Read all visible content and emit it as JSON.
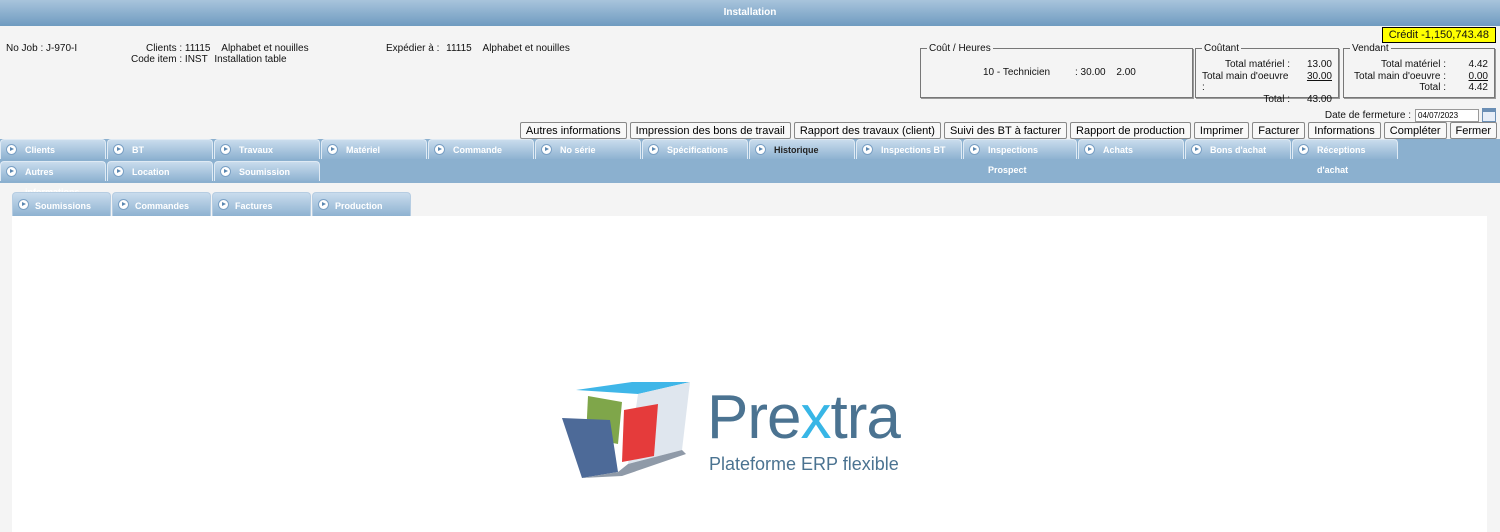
{
  "window": {
    "title": "Installation"
  },
  "credit": "Crédit -1,150,743.48",
  "job": {
    "no_job_label": "No Job :",
    "no_job_value": "J-970-I",
    "clients_label": "Clients :",
    "clients_code": "11115",
    "clients_name": "Alphabet et nouilles",
    "code_item_label": "Code item :",
    "code_item_code": "INST",
    "code_item_name": "Installation table",
    "expedier_label": "Expédier à :",
    "expedier_code": "11115",
    "expedier_name": "Alphabet et nouilles"
  },
  "cout_heures": {
    "legend": "Coût / Heures",
    "line": "10 - Technicien",
    "rate": ": 30.00",
    "hours": "2.00"
  },
  "coutant": {
    "legend": "Coûtant",
    "rows": [
      {
        "label": "Total matériel :",
        "value": "13.00"
      },
      {
        "label": "Total main d'oeuvre :",
        "value": "30.00"
      },
      {
        "label": "Total :",
        "value": "43.00"
      }
    ]
  },
  "vendant": {
    "legend": "Vendant",
    "rows": [
      {
        "label": "Total matériel :",
        "value": "4.42"
      },
      {
        "label": "Total main d'oeuvre :",
        "value": "0.00"
      },
      {
        "label": "Total :",
        "value": "4.42"
      }
    ]
  },
  "closing": {
    "label": "Date de fermeture :",
    "value": "04/07/2023",
    "icon": "calendar-icon"
  },
  "buttons": [
    "Autres informations",
    "Impression des bons de travail",
    "Rapport des travaux (client)",
    "Suivi des BT à facturer",
    "Rapport de production",
    "Imprimer",
    "Facturer",
    "Informations",
    "Compléter",
    "Fermer"
  ],
  "tabs_row1": [
    "Clients",
    "BT",
    "Travaux",
    "Matériel",
    "Commande",
    "No série",
    "Spécifications",
    "Historique",
    "Inspections BT",
    "Inspections Prospect",
    "Achats",
    "Bons d'achat",
    "Réceptions d'achat"
  ],
  "tabs_row2": [
    "Autres informations",
    "Location",
    "Soumission"
  ],
  "active_tab": "Historique",
  "subtabs": [
    "Soumissions",
    "Commandes",
    "Factures",
    "Production"
  ],
  "logo": {
    "name_a": "Pre",
    "name_x": "x",
    "name_b": "tra",
    "tagline": "Plateforme ERP flexible"
  },
  "colors": {
    "titlebar": "#6f9bc0",
    "tabs": "#8bb0cf",
    "credit_bg": "#ffff00",
    "logo_blue": "#4b7391",
    "logo_x": "#38b6e6"
  }
}
